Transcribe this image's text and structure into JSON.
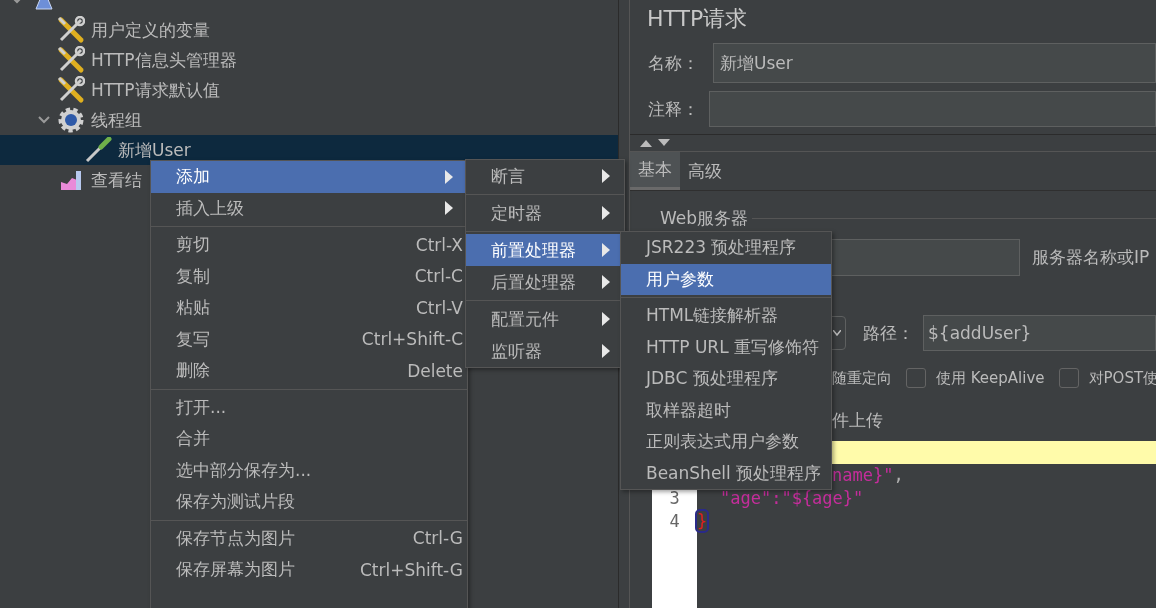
{
  "tree": [
    {
      "kind": "plan",
      "expanded": true,
      "selected": false,
      "children": [
        {
          "label": "用户定义的变量",
          "kind": "config",
          "selected": false
        },
        {
          "label": "HTTP信息头管理器",
          "kind": "config",
          "selected": false
        },
        {
          "label": "HTTP请求默认值",
          "kind": "config",
          "selected": false
        },
        {
          "label": "线程组",
          "kind": "thread-group",
          "expanded": true,
          "selected": false,
          "children": [
            {
              "label": "新增User",
              "kind": "sampler",
              "selected": true
            }
          ]
        },
        {
          "label": "查看结",
          "kind": "listener",
          "selected": false
        }
      ]
    }
  ],
  "panel": {
    "title": "HTTP请求",
    "name_label": "名称：",
    "name_value": "新增User",
    "comment_label": "注释：",
    "tabs": [
      {
        "label": "基本",
        "selected": true
      },
      {
        "label": "高级",
        "selected": false
      }
    ],
    "web_server_legend": "Web服务器",
    "server_label": "服务器名称或IP",
    "path_label": "路径：",
    "path_value": "${addUser}",
    "redirect_text": "随重定向",
    "options": [
      {
        "label": "使用 KeepAlive",
        "checked": false
      },
      {
        "label": "对POST使",
        "checked": false
      }
    ],
    "upload_text": "件上传"
  },
  "editor": {
    "lines": [
      {
        "current": true
      },
      {
        "current": false,
        "tokens": [
          {
            "text": "name}\"",
            "kind": "string"
          },
          {
            "text": ",",
            "kind": "punct"
          }
        ]
      },
      {
        "current": false,
        "number": "3",
        "indent": true,
        "tokens": [
          {
            "text": "\"age\":\"${age}\"",
            "kind": "string"
          }
        ]
      },
      {
        "current": false,
        "number": "4",
        "tokens": [
          {
            "text": "}",
            "kind": "bracket"
          }
        ]
      }
    ]
  },
  "menu": {
    "groups": [
      [
        {
          "label": "添加",
          "submenu": true,
          "selected": true,
          "disabled": false
        },
        {
          "label": "插入上级",
          "submenu": true,
          "selected": false,
          "disabled": false
        }
      ],
      [
        {
          "label": "剪切",
          "shortcut": "Ctrl-X",
          "submenu": false,
          "selected": false,
          "disabled": false
        },
        {
          "label": "复制",
          "shortcut": "Ctrl-C",
          "submenu": false,
          "selected": false,
          "disabled": false
        },
        {
          "label": "粘贴",
          "shortcut": "Ctrl-V",
          "submenu": false,
          "selected": false,
          "disabled": false
        },
        {
          "label": "复写",
          "shortcut": "Ctrl+Shift-C",
          "submenu": false,
          "selected": false,
          "disabled": false
        },
        {
          "label": "删除",
          "shortcut": "Delete",
          "submenu": false,
          "selected": false,
          "disabled": false
        }
      ],
      [
        {
          "label": "打开...",
          "submenu": false,
          "selected": false,
          "disabled": false
        },
        {
          "label": "合并",
          "submenu": false,
          "selected": false,
          "disabled": false
        },
        {
          "label": "选中部分保存为...",
          "submenu": false,
          "selected": false,
          "disabled": false
        },
        {
          "label": "保存为测试片段",
          "submenu": false,
          "selected": false,
          "disabled": false
        }
      ],
      [
        {
          "label": "保存节点为图片",
          "shortcut": "Ctrl-G",
          "submenu": false,
          "selected": false,
          "disabled": false
        },
        {
          "label": "保存屏幕为图片",
          "shortcut": "Ctrl+Shift-G",
          "submenu": false,
          "selected": false,
          "disabled": false
        }
      ]
    ]
  },
  "submenu_add": {
    "groups": [
      [
        {
          "label": "断言",
          "submenu": true,
          "selected": false,
          "disabled": false
        }
      ],
      [
        {
          "label": "定时器",
          "submenu": true,
          "selected": false,
          "disabled": false
        }
      ],
      [
        {
          "label": "前置处理器",
          "submenu": true,
          "selected": true,
          "disabled": false
        },
        {
          "label": "后置处理器",
          "submenu": true,
          "selected": false,
          "disabled": false
        }
      ],
      [
        {
          "label": "配置元件",
          "submenu": true,
          "selected": false,
          "disabled": false
        },
        {
          "label": "监听器",
          "submenu": true,
          "selected": false,
          "disabled": false
        }
      ]
    ]
  },
  "submenu_pre": {
    "groups": [
      [
        {
          "label": "JSR223 预处理程序",
          "submenu": false,
          "selected": false,
          "disabled": false
        },
        {
          "label": "用户参数",
          "submenu": false,
          "selected": true,
          "disabled": false
        }
      ],
      [
        {
          "label": "HTML链接解析器",
          "submenu": false,
          "selected": false,
          "disabled": false
        },
        {
          "label": "HTTP URL 重写修饰符",
          "submenu": false,
          "selected": false,
          "disabled": false
        },
        {
          "label": "JDBC 预处理程序",
          "submenu": false,
          "selected": false,
          "disabled": false
        },
        {
          "label": "取样器超时",
          "submenu": false,
          "selected": false,
          "disabled": false
        },
        {
          "label": "正则表达式用户参数",
          "submenu": false,
          "selected": false,
          "disabled": false
        },
        {
          "label": "BeanShell 预处理程序",
          "submenu": false,
          "selected": false,
          "disabled": false
        }
      ]
    ]
  }
}
